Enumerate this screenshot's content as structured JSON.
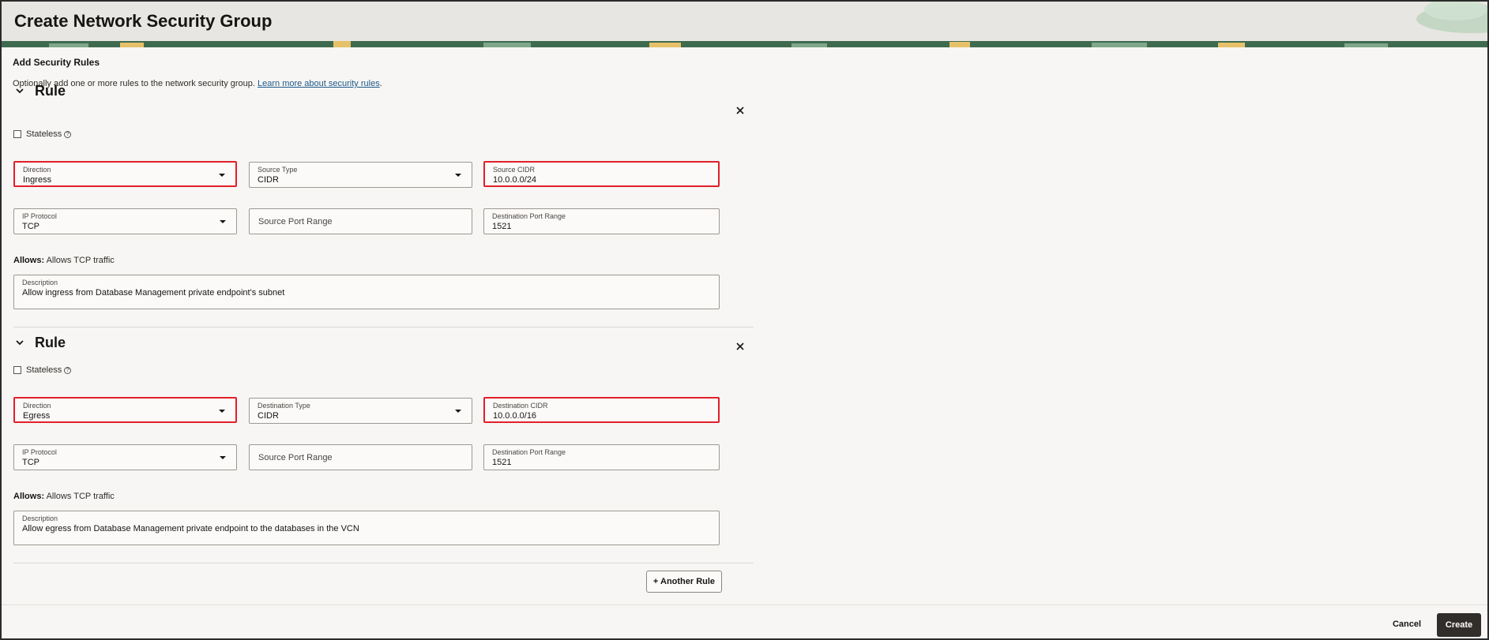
{
  "header": {
    "title": "Create Network Security Group"
  },
  "section": {
    "title": "Add Security Rules",
    "intro_text": "Optionally add one or more rules to the network security group.",
    "learn_link": "Learn more about security rules",
    "intro_period": "."
  },
  "rules": [
    {
      "title": "Rule",
      "stateless_label": "Stateless",
      "direction": {
        "label": "Direction",
        "value": "Ingress"
      },
      "type": {
        "label": "Source Type",
        "value": "CIDR"
      },
      "cidr": {
        "label": "Source CIDR",
        "value": "10.0.0.0/24"
      },
      "ip_protocol": {
        "label": "IP Protocol",
        "value": "TCP"
      },
      "source_port_placeholder": "Source Port Range",
      "dest_port": {
        "label": "Destination Port Range",
        "value": "1521"
      },
      "allows_label": "Allows:",
      "allows_text": "Allows TCP traffic",
      "description": {
        "label": "Description",
        "value": "Allow ingress from Database Management private endpoint's subnet"
      }
    },
    {
      "title": "Rule",
      "stateless_label": "Stateless",
      "direction": {
        "label": "Direction",
        "value": "Egress"
      },
      "type": {
        "label": "Destination Type",
        "value": "CIDR"
      },
      "cidr": {
        "label": "Destination CIDR",
        "value": "10.0.0.0/16"
      },
      "ip_protocol": {
        "label": "IP Protocol",
        "value": "TCP"
      },
      "source_port_placeholder": "Source Port Range",
      "dest_port": {
        "label": "Destination Port Range",
        "value": "1521"
      },
      "allows_label": "Allows:",
      "allows_text": "Allows TCP traffic",
      "description": {
        "label": "Description",
        "value": "Allow egress from Database Management private endpoint to the databases in the VCN"
      }
    }
  ],
  "another_rule_label": "+ Another Rule",
  "footer": {
    "cancel_label": "Cancel",
    "create_label": "Create"
  },
  "colors": {
    "highlight": "#e0202a",
    "primary_button": "#312d2a",
    "link": "#1e5a8a"
  },
  "icons": {
    "rule_toggle": "chevron-down-icon",
    "remove_rule": "close-icon",
    "help": "help-circle-icon",
    "dropdown": "caret-down-icon"
  }
}
